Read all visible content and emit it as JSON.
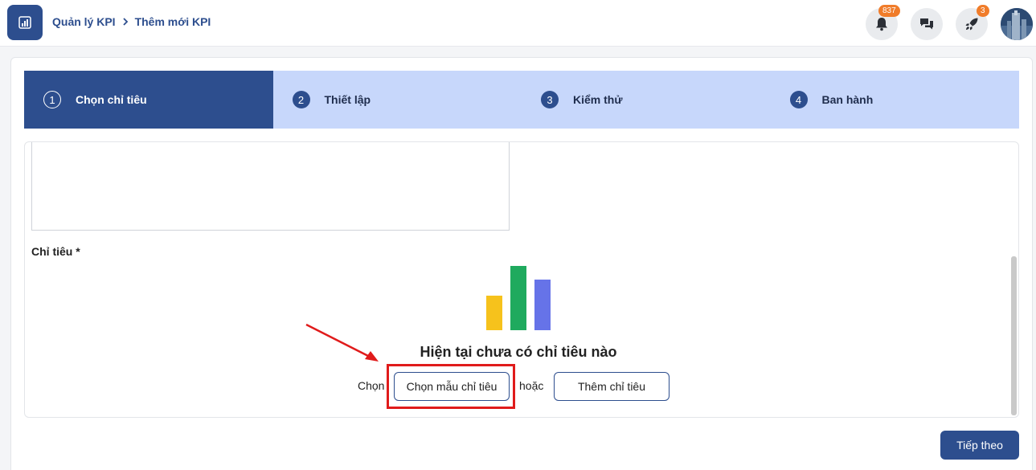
{
  "header": {
    "breadcrumb": [
      "Quản lý KPI",
      "Thêm mới KPI"
    ],
    "notifications_count": "837",
    "rocket_count": "3"
  },
  "stepper": [
    {
      "num": "1",
      "label": "Chọn chỉ tiêu",
      "active": true
    },
    {
      "num": "2",
      "label": "Thiết lập",
      "active": false
    },
    {
      "num": "3",
      "label": "Kiểm thử",
      "active": false
    },
    {
      "num": "4",
      "label": "Ban hành",
      "active": false
    }
  ],
  "form": {
    "criteria_label": "Chỉ tiêu *",
    "empty_title": "Hiện tại chưa có chỉ tiêu nào",
    "choose_text": "Chọn",
    "template_button": "Chọn mẫu chỉ tiêu",
    "or_text": "hoặc",
    "add_button": "Thêm chỉ tiêu"
  },
  "footer": {
    "next_button": "Tiếp theo"
  },
  "colors": {
    "primary": "#2d4e8e",
    "step_inactive": "#c7d7fb",
    "badge": "#f07c2a",
    "highlight": "#e01b1b",
    "chart_bars": [
      "#f6c21c",
      "#1faa5e",
      "#6673e8"
    ]
  }
}
